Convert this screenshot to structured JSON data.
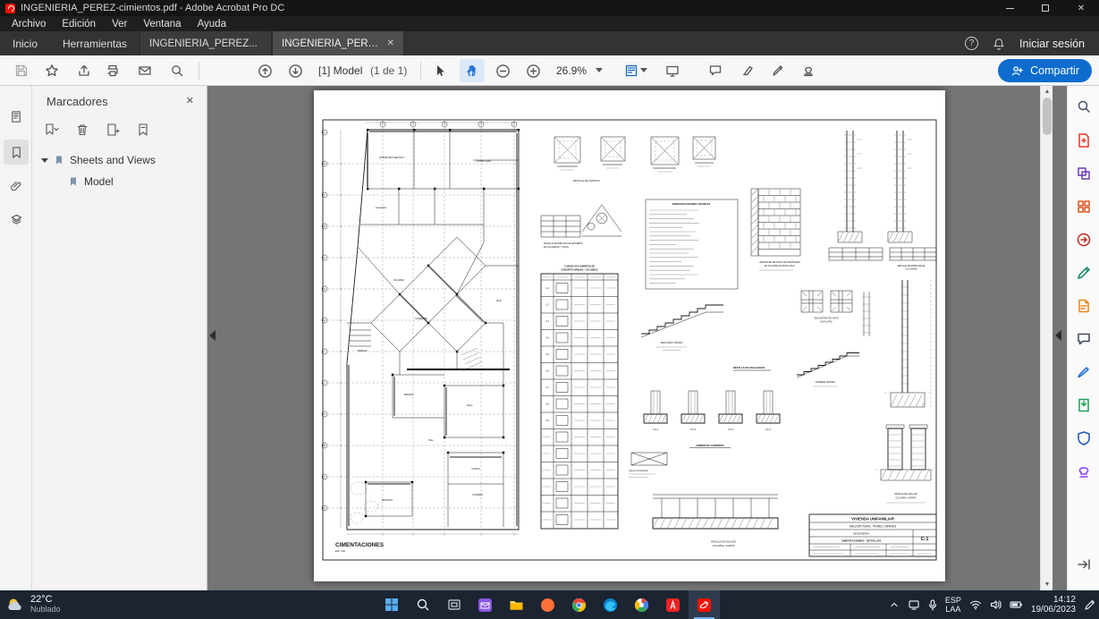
{
  "titlebar": {
    "title": "INGENIERIA_PEREZ-cimientos.pdf - Adobe Acrobat Pro DC"
  },
  "icons": {
    "close": "✕",
    "help": "?",
    "tab_close": "✕",
    "scroll_up": "▲",
    "scroll_down": "▼"
  },
  "menubar": {
    "items": [
      "Archivo",
      "Edición",
      "Ver",
      "Ventana",
      "Ayuda"
    ]
  },
  "tabbar": {
    "home": "Inicio",
    "tools": "Herramientas",
    "tab1": "INGENIERIA_PEREZ...",
    "tab2": "INGENIERIA_PEREZ...",
    "sign_in": "Iniciar sesión"
  },
  "toolbar": {
    "page_label": "[1] Model",
    "page_count": "(1 de 1)",
    "zoom": "26.9%",
    "share": "Compartir"
  },
  "bookmarks": {
    "title": "Marcadores",
    "root": "Sheets and Views",
    "child": "Model"
  },
  "drawing": {
    "plan_title": "CIMENTACIONES",
    "plan_scale": "ESC. 1/50",
    "grid_numbers": [
      "1",
      "2",
      "3",
      "4",
      "5"
    ],
    "grid_letters": [
      "A",
      "B",
      "C",
      "D",
      "F",
      "G",
      "H",
      "I",
      "J",
      "K",
      "M",
      "O",
      "Q"
    ],
    "rooms": {
      "dormitorio_servicio": "DORMITORIO SERVICIO",
      "dormitorio": "DORMITORIO",
      "lavanderia": "Lavandería",
      "comedor": "COMEDOR",
      "columna": "COLUMNA",
      "bar": "BAR",
      "terraza1": "TERRAZA",
      "terraza2": "TERRAZA",
      "sala": "SALA",
      "hall": "HALL",
      "cocina": "COCINA",
      "cochera": "COCHERA",
      "deposito": "DEPOSITO"
    },
    "labels": {
      "detalle_zapatas": "DETALLE DE ZAPATAS",
      "doblado_1": "DETALLE DE DOBLADO DE ESTRIBOS",
      "doblado_2": "EN COLUMNAS Y VIGAS",
      "cuadro_1": "CUADRO DE ELEMENTOS DE",
      "cuadro_2": "CONCRETO ARMADO - COLUMNAS",
      "especificaciones": "ESPECIFICACIONES TECNICAS",
      "arriostre_1": "ARRIOSTRE DE MURO DE ALBAÑILERIA",
      "arriostre_2": "EN COLUMNA ESTRUCTURAL",
      "empalme_1": "DETALLE DE EMPALME DE",
      "empalme_2": "COLUMNAS",
      "encuentro_1": "ENCUENTRO DE VIGAS",
      "encuentro_2": "EN PLANTA",
      "segundo_tramo": "SEGUNDO TRAMO",
      "primer_tramo": "PRIMER TRAMO",
      "detalle_escaleras": "DETALLE DE ESCALERAS",
      "cimientos_corridos": "CIMIENTOS CORRIDOS",
      "viga_cimentacion": "Viga de Cimentacion",
      "anclaje1_1": "DETALLE DE ANCLAJE",
      "anclaje1_2": "COLUMNA - ZAPATA",
      "anclaje2_1": "DETALLE DE ANCLAJE",
      "anclaje2_2": "COLUMNA + ZAPATA",
      "cc1": "CC-1",
      "cc2": "CC-2",
      "cc3": "CC-3",
      "cc4": "CC-4"
    },
    "column_rows": [
      "C-1",
      "C-2",
      "C-3",
      "C-4",
      "C-5",
      "C-6",
      "C-7",
      "C-8",
      "C-9"
    ],
    "title_block": {
      "line1": "VIVIENDA UNIFAMILIAR",
      "line2": "HALDOR ISAAC. PEREZ LINARES",
      "line3": "INGENIERIA",
      "line4": "CIMENTACIONES - DETALLES",
      "sheet": "C-1"
    }
  },
  "taskbar": {
    "weather": {
      "temp": "22°C",
      "desc": "Nublado"
    },
    "lang": {
      "line1": "ESP",
      "line2": "LAA"
    },
    "clock": {
      "time": "14:12",
      "date": "19/06/2023"
    }
  }
}
